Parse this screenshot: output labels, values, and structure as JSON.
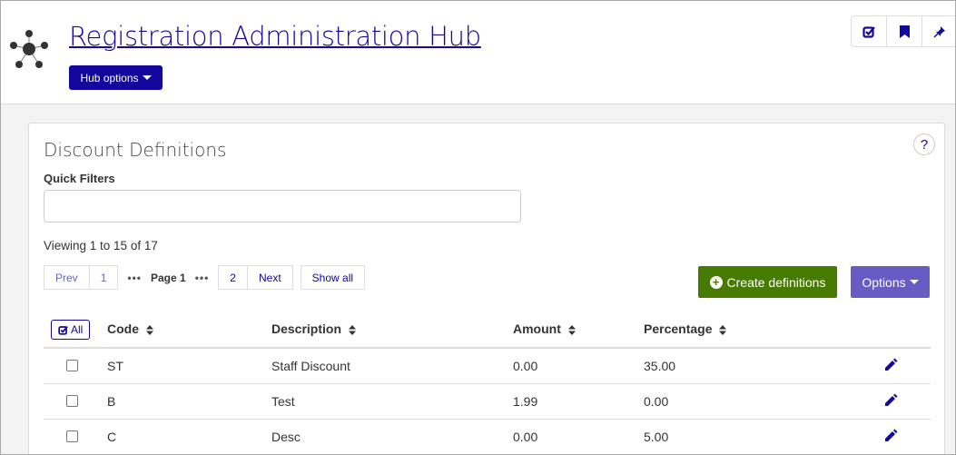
{
  "header": {
    "title": "Registration Administration Hub",
    "hub_options": "Hub options",
    "tools": [
      "checklist-icon",
      "bookmark-icon",
      "pin-icon"
    ]
  },
  "card": {
    "title": "Discount Definitions",
    "help": "?",
    "quick_filters_label": "Quick Filters",
    "quick_filters_value": "",
    "viewing": "Viewing 1 to 15 of 17"
  },
  "pager": {
    "prev": "Prev",
    "first": "1",
    "dots": "•••",
    "current": "Page 1",
    "next_page": "2",
    "next": "Next",
    "show_all": "Show all"
  },
  "actions": {
    "create": "Create definitions",
    "options": "Options"
  },
  "table": {
    "all_label": "All",
    "columns": [
      "Code",
      "Description",
      "Amount",
      "Percentage"
    ],
    "rows": [
      {
        "code": "ST",
        "description": "Staff Discount",
        "amount": "0.00",
        "percentage": "35.00"
      },
      {
        "code": "B",
        "description": "Test",
        "amount": "1.99",
        "percentage": "0.00"
      },
      {
        "code": "C",
        "description": "Desc",
        "amount": "0.00",
        "percentage": "5.00"
      }
    ]
  },
  "colors": {
    "primary": "#12069c",
    "create": "#467a00",
    "options": "#675bc4"
  }
}
